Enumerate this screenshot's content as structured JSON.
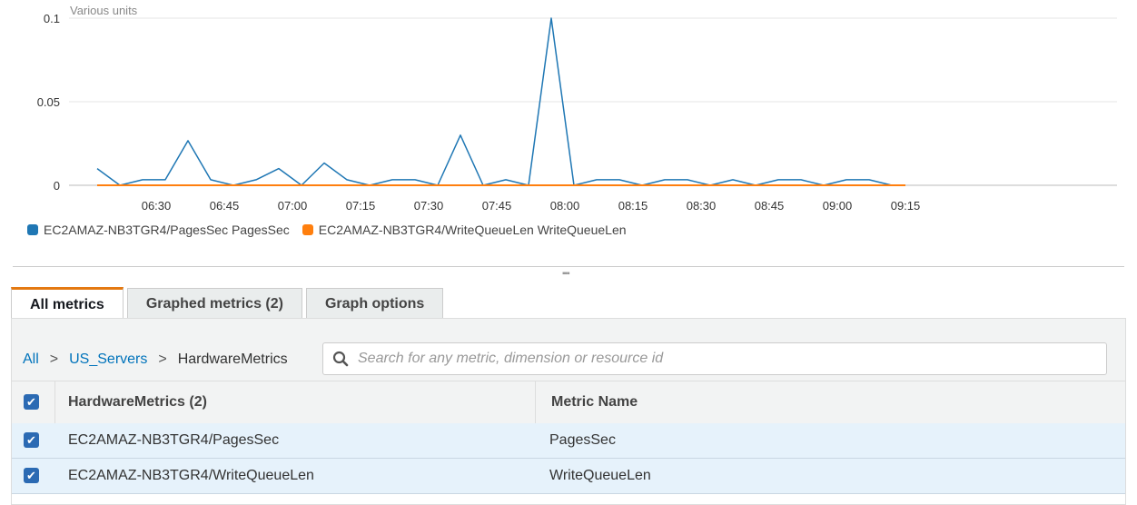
{
  "chart_data": {
    "type": "line",
    "unit_label": "Various units",
    "y_ticks": [
      "0.1",
      "0.05",
      "0"
    ],
    "x_tick_labels": [
      "06:30",
      "06:45",
      "07:00",
      "07:15",
      "07:30",
      "07:45",
      "08:00",
      "08:15",
      "08:30",
      "08:45",
      "09:00",
      "09:15"
    ],
    "ylim": [
      0,
      0.1
    ],
    "x": [
      "06:17",
      "06:22",
      "06:27",
      "06:32",
      "06:37",
      "06:42",
      "06:47",
      "06:52",
      "06:57",
      "07:02",
      "07:07",
      "07:12",
      "07:17",
      "07:22",
      "07:27",
      "07:32",
      "07:37",
      "07:42",
      "07:47",
      "07:52",
      "07:57",
      "08:02",
      "08:07",
      "08:12",
      "08:17",
      "08:22",
      "08:27",
      "08:32",
      "08:37",
      "08:42",
      "08:47",
      "08:52",
      "08:57",
      "09:02",
      "09:07",
      "09:12",
      "09:15"
    ],
    "series": [
      {
        "name": "EC2AMAZ-NB3TGR4/PagesSec PagesSec",
        "color": "#1f77b4",
        "values": [
          0.01,
          0,
          0.0033,
          0.0033,
          0.0267,
          0.0033,
          0,
          0.0033,
          0.01,
          0,
          0.0133,
          0.0033,
          0,
          0.0033,
          0.0033,
          0,
          0.03,
          0,
          0.0033,
          0,
          0.1,
          0,
          0.0033,
          0.0033,
          0,
          0.0033,
          0.0033,
          0,
          0.0033,
          0,
          0.0033,
          0.0033,
          0,
          0.0033,
          0.0033,
          0,
          0
        ]
      },
      {
        "name": "EC2AMAZ-NB3TGR4/WriteQueueLen WriteQueueLen",
        "color": "#ff7f0e",
        "values": [
          0,
          0,
          0,
          0,
          0,
          0,
          0,
          0,
          0,
          0,
          0,
          0,
          0,
          0,
          0,
          0,
          0,
          0,
          0,
          0,
          0,
          0,
          0,
          0,
          0,
          0,
          0,
          0,
          0,
          0,
          0,
          0,
          0,
          0,
          0,
          0,
          0
        ]
      }
    ]
  },
  "tabs": [
    {
      "label": "All metrics",
      "active": true
    },
    {
      "label": "Graphed metrics (2)",
      "active": false
    },
    {
      "label": "Graph options",
      "active": false
    }
  ],
  "breadcrumb": {
    "all": "All",
    "namespace": "US_Servers",
    "current": "HardwareMetrics",
    "sep": ">"
  },
  "search": {
    "placeholder": "Search for any metric, dimension or resource id"
  },
  "table": {
    "headers": [
      "HardwareMetrics (2)",
      "Metric Name"
    ],
    "rows": [
      {
        "dimension": "EC2AMAZ-NB3TGR4/PagesSec",
        "metric": "PagesSec",
        "checked": true
      },
      {
        "dimension": "EC2AMAZ-NB3TGR4/WriteQueueLen",
        "metric": "WriteQueueLen",
        "checked": true
      }
    ]
  },
  "icons": {
    "checkbox": "checkmark-icon",
    "search": "search-icon",
    "grip": "resize-grip-icon"
  }
}
